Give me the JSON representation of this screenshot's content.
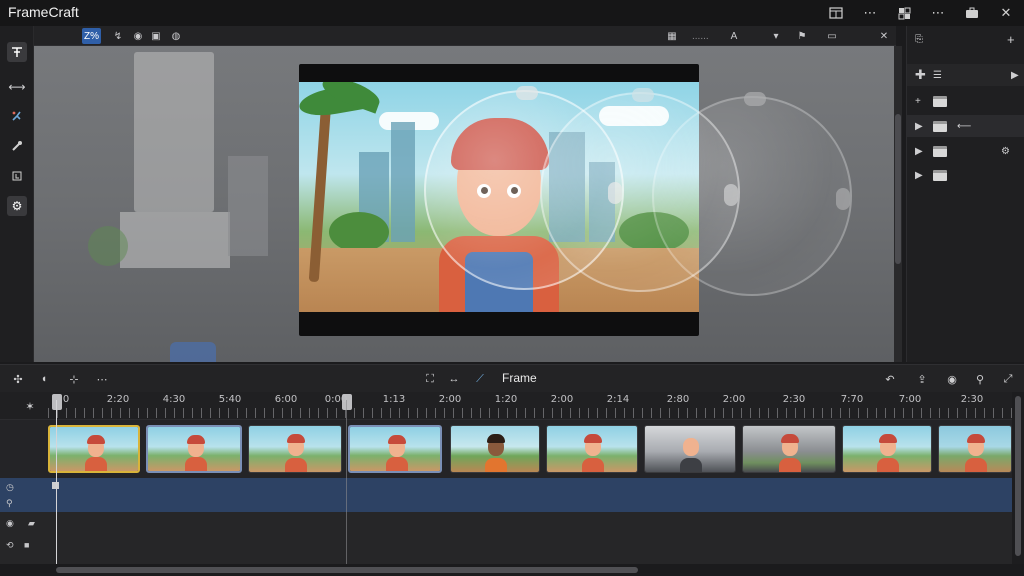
{
  "app": {
    "title": "FrameCraft"
  },
  "titlebar_icons": [
    "panel-layout-icon",
    "more-icon",
    "grid-icon",
    "more-icon",
    "briefcase-icon",
    "close-icon"
  ],
  "viewer_toolbar": {
    "zoom_label": "Z%",
    "icons": [
      "transform-icon",
      "record-icon",
      "audio-icon",
      "comment-icon",
      "flag-icon",
      "monitor-icon",
      "close-icon"
    ],
    "range_label": "......",
    "crop_label": "A"
  },
  "left_tools": [
    "text-tool-icon",
    "move-icon",
    "effects-icon",
    "brush-icon",
    "adjust-icon",
    "settings-icon"
  ],
  "right_panel": {
    "header_add": "+",
    "layers": [
      {
        "expanded": false,
        "selected": false
      },
      {
        "expanded": false,
        "selected": false
      },
      {
        "expanded": false,
        "selected": true
      },
      {
        "expanded": false,
        "selected": false
      },
      {
        "expanded": false,
        "selected": false
      }
    ]
  },
  "timeline_toolbar": {
    "label": "Frame"
  },
  "ruler": {
    "labels": [
      "0",
      "2:20",
      "4:30",
      "5:40",
      "6:00",
      "0:00",
      "1:13",
      "2:00",
      "1:20",
      "2:00",
      "2:14",
      "2:80",
      "2:00",
      "2:30",
      "7:70",
      "7:00",
      "2:30"
    ]
  },
  "clips": [
    {
      "theme": "city",
      "selected": true
    },
    {
      "theme": "city",
      "selected": true
    },
    {
      "theme": "city",
      "selected": false
    },
    {
      "theme": "city",
      "selected": true
    },
    {
      "theme": "friend",
      "selected": false
    },
    {
      "theme": "city",
      "selected": false
    },
    {
      "theme": "room",
      "selected": false
    },
    {
      "theme": "room2",
      "selected": false
    },
    {
      "theme": "city",
      "selected": false
    },
    {
      "theme": "city2",
      "selected": false
    }
  ],
  "colors": {
    "accent": "#2f5fa8",
    "clip_selected": "#d9b43a",
    "audio_track": "#2d4264"
  }
}
